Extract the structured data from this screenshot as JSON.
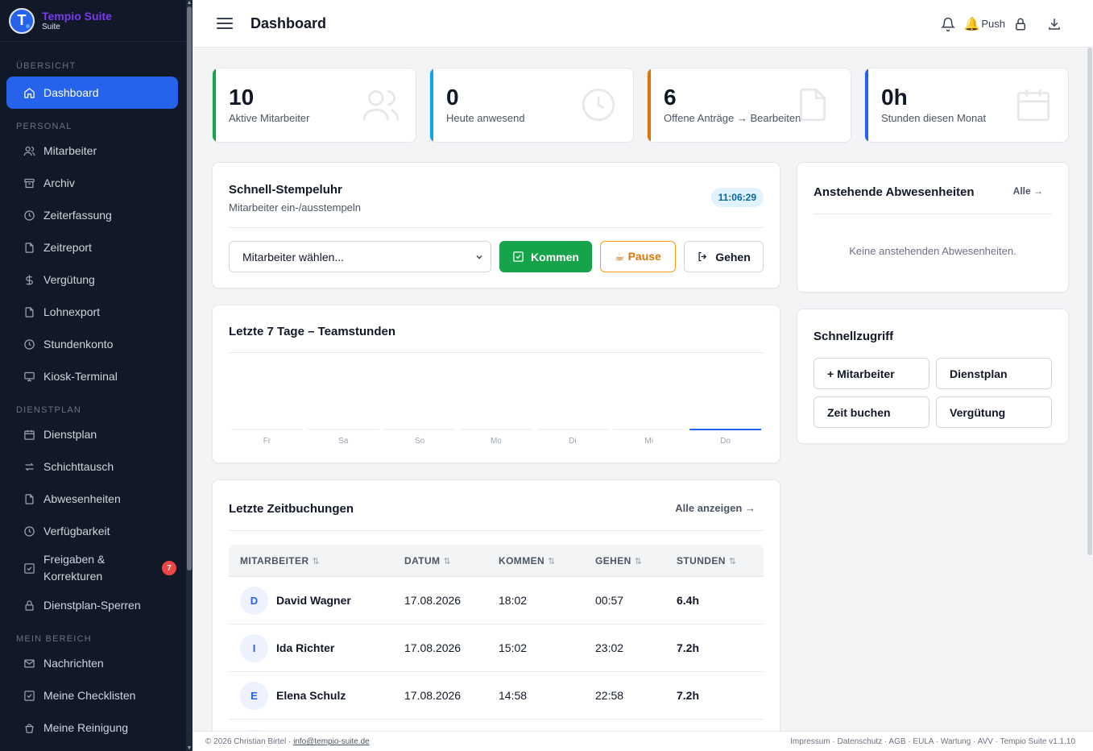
{
  "brand": {
    "name": "Tempio Suite",
    "sub": "Suite",
    "logo_letter": "T"
  },
  "sidebar": {
    "sections": [
      {
        "label": "Übersicht",
        "items": [
          {
            "label": "Dashboard",
            "icon": "home-icon",
            "active": true
          }
        ]
      },
      {
        "label": "Personal",
        "items": [
          {
            "label": "Mitarbeiter",
            "icon": "users-icon"
          },
          {
            "label": "Archiv",
            "icon": "archive-icon"
          },
          {
            "label": "Zeiterfassung",
            "icon": "clock-icon"
          },
          {
            "label": "Zeitreport",
            "icon": "file-icon"
          },
          {
            "label": "Vergütung",
            "icon": "dollar-icon"
          },
          {
            "label": "Lohnexport",
            "icon": "file-icon"
          },
          {
            "label": "Stundenkonto",
            "icon": "clock-icon"
          },
          {
            "label": "Kiosk-Terminal",
            "icon": "monitor-icon"
          }
        ]
      },
      {
        "label": "Dienstplan",
        "items": [
          {
            "label": "Dienstplan",
            "icon": "calendar-icon"
          },
          {
            "label": "Schichttausch",
            "icon": "swap-icon"
          },
          {
            "label": "Abwesenheiten",
            "icon": "file-icon"
          },
          {
            "label": "Verfügbarkeit",
            "icon": "clock-icon"
          },
          {
            "label": "Freigaben & Korrekturen",
            "icon": "check-square-icon",
            "badge": "7"
          },
          {
            "label": "Dienstplan-Sperren",
            "icon": "lock-icon"
          }
        ]
      },
      {
        "label": "Mein Bereich",
        "items": [
          {
            "label": "Nachrichten",
            "icon": "mail-icon"
          },
          {
            "label": "Meine Checklisten",
            "icon": "check-square-icon"
          },
          {
            "label": "Meine Reinigung",
            "icon": "bucket-icon"
          }
        ]
      }
    ]
  },
  "header": {
    "title": "Dashboard",
    "push_label": "Push"
  },
  "stats": [
    {
      "value": "10",
      "label": "Aktive Mitarbeiter",
      "color": "#16a34a",
      "icon": "users-icon"
    },
    {
      "value": "0",
      "label": "Heute anwesend",
      "color": "#0ea5e9",
      "icon": "clock-icon"
    },
    {
      "value": "6",
      "label": "Offene Anträge → Bearbeiten",
      "color": "#d97706",
      "icon": "file-icon"
    },
    {
      "value": "0h",
      "label": "Stunden diesen Monat",
      "color": "#2563eb",
      "icon": "calendar-icon"
    }
  ],
  "stempeluhr": {
    "title": "Schnell-Stempeluhr",
    "subtitle": "Mitarbeiter ein-/ausstempeln",
    "time": "11:06:29",
    "select_value": "Mitarbeiter wählen...",
    "btn_in": "Kommen",
    "btn_pause": "☕ Pause",
    "btn_out": "Gehen"
  },
  "chart_data": {
    "type": "bar",
    "title": "Letzte 7 Tage – Teamstunden",
    "categories": [
      "Fr",
      "Sa",
      "So",
      "Mo",
      "Di",
      "Mi",
      "Do"
    ],
    "values": [
      0,
      0,
      0,
      0,
      0,
      0,
      0
    ],
    "highlight_category": "Do",
    "highlight_color": "#2563eb",
    "base_color": "#f3f4f6"
  },
  "bookings": {
    "title": "Letzte Zeitbuchungen",
    "link": "Alle anzeigen →",
    "columns": [
      "Mitarbeiter",
      "Datum",
      "Kommen",
      "Gehen",
      "Stunden"
    ],
    "rows": [
      {
        "initial": "D",
        "name": "David Wagner",
        "date": "17.08.2026",
        "in": "18:02",
        "out": "00:57",
        "hours": "6.4h"
      },
      {
        "initial": "I",
        "name": "Ida Richter",
        "date": "17.08.2026",
        "in": "15:02",
        "out": "23:02",
        "hours": "7.2h"
      },
      {
        "initial": "E",
        "name": "Elena Schulz",
        "date": "17.08.2026",
        "in": "14:58",
        "out": "22:58",
        "hours": "7.2h"
      }
    ]
  },
  "absences": {
    "title": "Anstehende Abwesenheiten",
    "link": "Alle →",
    "empty": "Keine anstehenden Abwesenheiten."
  },
  "quick": {
    "title": "Schnellzugriff",
    "buttons": [
      "+ Mitarbeiter",
      "Dienstplan",
      "Zeit buchen",
      "Vergütung"
    ]
  },
  "footer": {
    "copyright": "© 2026 Christian Birtel ·",
    "email": "info@tempio-suite.de",
    "links": "Impressum · Datenschutz · AGB · EULA · Wartung · AVV · Tempio Suite v1.1.10"
  }
}
